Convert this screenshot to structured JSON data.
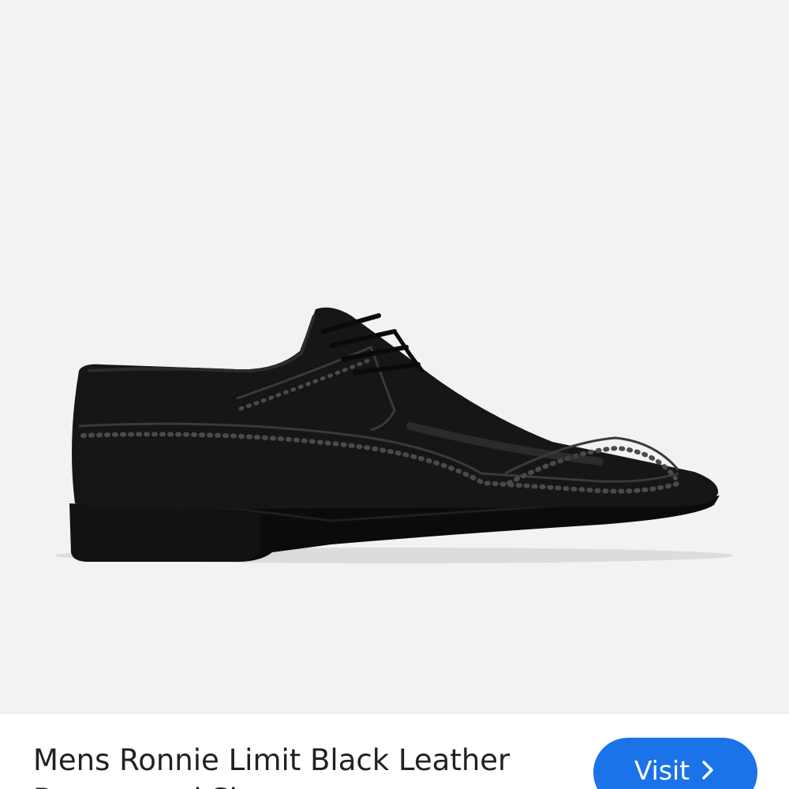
{
  "product": {
    "image_alt": "Black leather brogue shoe",
    "title": "Mens Ronnie Limit Black Leather Brogue and Shoes"
  },
  "actions": {
    "visit_label": "Visit",
    "visit_icon": "chevron-right-icon"
  },
  "colors": {
    "image_background": "#f2f2f2",
    "button": "#1a73e8",
    "title_text": "#202124"
  }
}
